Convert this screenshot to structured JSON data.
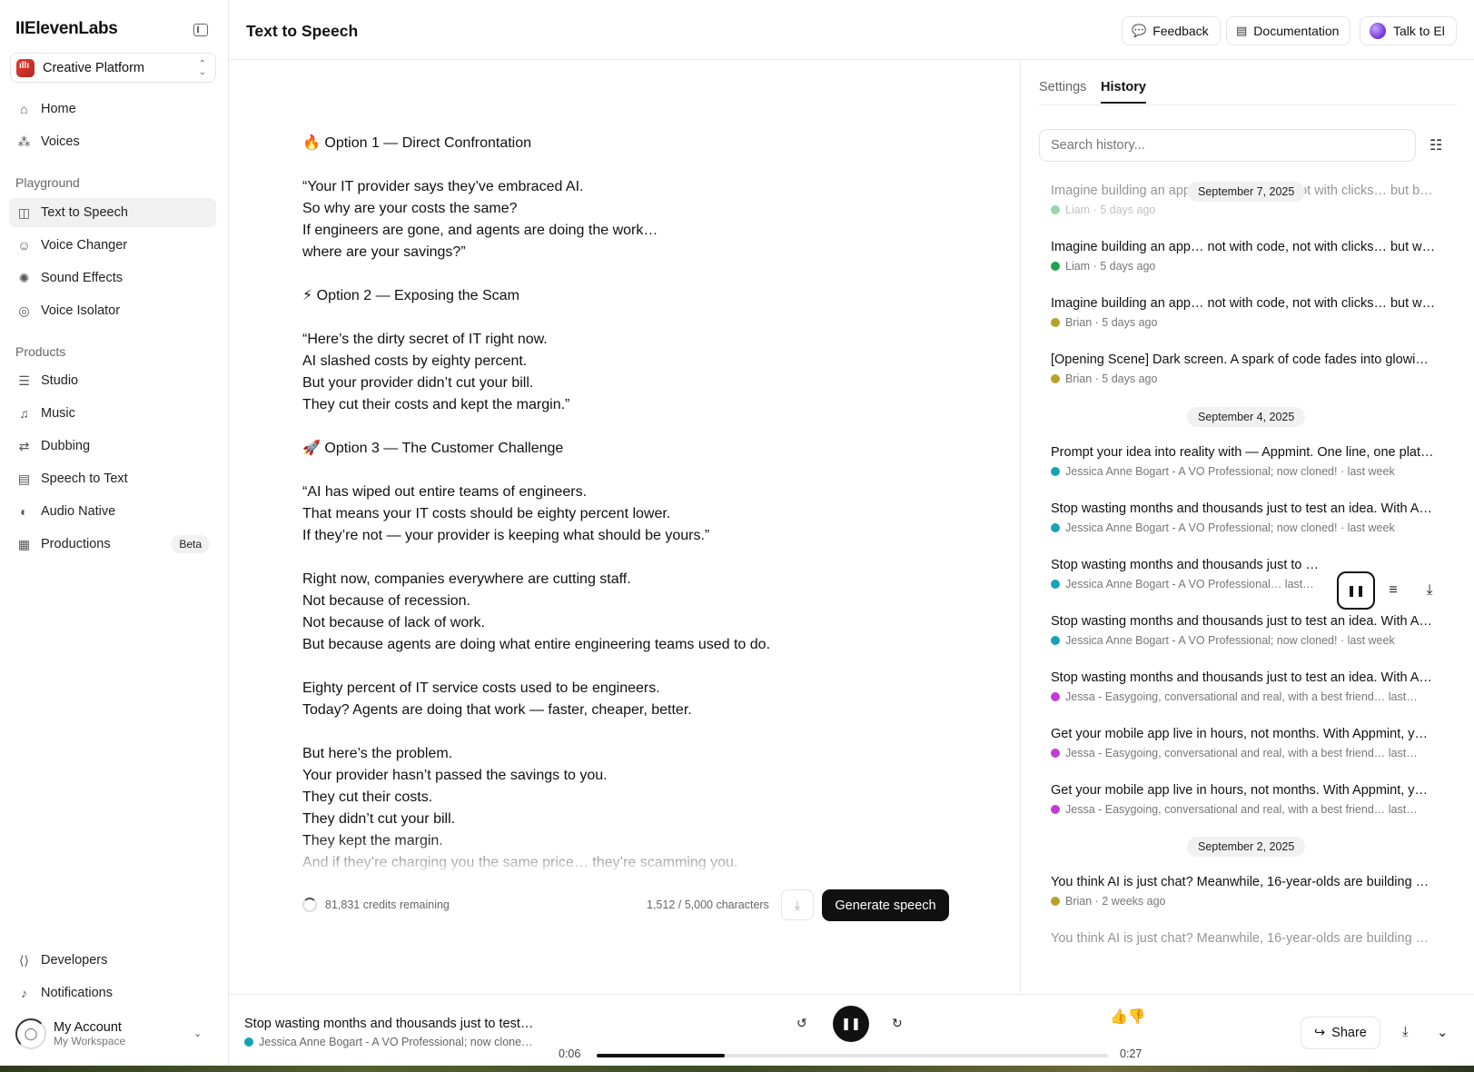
{
  "app": {
    "logo": "IIElevenLabs",
    "workspace_switcher": "Creative Platform",
    "page_title": "Text to Speech"
  },
  "sidebar": {
    "top_items": [
      {
        "label": "Home",
        "icon": "home-icon"
      },
      {
        "label": "Voices",
        "icon": "voices-icon"
      }
    ],
    "playground_label": "Playground",
    "playground_items": [
      {
        "label": "Text to Speech",
        "icon": "tts-icon",
        "active": true
      },
      {
        "label": "Voice Changer",
        "icon": "voice-changer-icon"
      },
      {
        "label": "Sound Effects",
        "icon": "sound-effects-icon"
      },
      {
        "label": "Voice Isolator",
        "icon": "voice-isolator-icon"
      }
    ],
    "products_label": "Products",
    "products_items": [
      {
        "label": "Studio",
        "icon": "studio-icon"
      },
      {
        "label": "Music",
        "icon": "music-icon"
      },
      {
        "label": "Dubbing",
        "icon": "dubbing-icon"
      },
      {
        "label": "Speech to Text",
        "icon": "speech-to-text-icon"
      },
      {
        "label": "Audio Native",
        "icon": "audio-native-icon"
      },
      {
        "label": "Productions",
        "icon": "productions-icon",
        "badge": "Beta"
      }
    ],
    "bottom_items": [
      {
        "label": "Developers",
        "icon": "developers-icon"
      },
      {
        "label": "Notifications",
        "icon": "bell-icon"
      }
    ],
    "account": {
      "name": "My Account",
      "workspace": "My Workspace"
    }
  },
  "header": {
    "feedback": "Feedback",
    "documentation": "Documentation",
    "talk": "Talk to El"
  },
  "editor": {
    "lines": [
      "🔥 Option 1 — Direct Confrontation",
      "",
      "“Your IT provider says they’ve embraced AI.",
      "So why are your costs the same?",
      "If engineers are gone, and agents are doing the work…",
      "where are your savings?”",
      "",
      "⚡ Option 2 — Exposing the Scam",
      "",
      "“Here’s the dirty secret of IT right now.",
      "AI slashed costs by eighty percent.",
      "But your provider didn’t cut your bill.",
      "They cut their costs and kept the margin.”",
      "",
      "🚀 Option 3 — The Customer Challenge",
      "",
      "“AI has wiped out entire teams of engineers.",
      "That means your IT costs should be eighty percent lower.",
      "If they’re not — your provider is keeping what should be yours.”",
      "",
      "Right now, companies everywhere are cutting staff.",
      "Not because of recession.",
      "Not because of lack of work.",
      "But because agents are doing what entire engineering teams used to do.",
      "",
      "Eighty percent of IT service costs used to be engineers.",
      "Today? Agents are doing that work — faster, cheaper, better.",
      "",
      "But here’s the problem.",
      "Your provider hasn’t passed the savings to you.",
      "They cut their costs.",
      "They didn’t cut your bill.",
      "They kept the margin.",
      "And if they’re charging you the same price… they’re scamming you."
    ],
    "credits": "81,831 credits remaining",
    "characters": "1,512 / 5,000 characters",
    "generate": "Generate speech"
  },
  "history": {
    "tabs": [
      "Settings",
      "History"
    ],
    "active_tab": "History",
    "search_placeholder": "Search history...",
    "dates": [
      "September 7, 2025",
      "September 4, 2025",
      "September 2, 2025"
    ],
    "items": [
      {
        "title": "Imagine building an app… not with code, not with clicks… but b…",
        "meta": "Liam · 5 days ago",
        "color": "#1fa34a",
        "dim": true
      },
      {
        "title": "Imagine building an app… not with code, not with clicks… but w…",
        "meta": "Liam · 5 days ago",
        "color": "#1fa34a"
      },
      {
        "title": "Imagine building an app… not with code, not with clicks… but w…",
        "meta": "Brian · 5 days ago",
        "color": "#b8a12a"
      },
      {
        "title": "[Opening Scene] Dark screen. A spark of code fades into glowi…",
        "meta": "Brian · 5 days ago",
        "color": "#b8a12a"
      },
      {
        "title": "Prompt your idea into reality with — Appmint. One line, one plat…",
        "meta": "Jessica Anne Bogart - A VO Professional; now cloned! · last week",
        "color": "#17a2b8"
      },
      {
        "title": "Stop wasting months and thousands just to test an idea. With A…",
        "meta": "Jessica Anne Bogart - A VO Professional; now cloned! · last week",
        "color": "#17a2b8"
      },
      {
        "title": "Stop wasting months and thousands just to …",
        "meta": "Jessica Anne Bogart - A VO Professional… last…",
        "color": "#17a2b8"
      },
      {
        "title": "Stop wasting months and thousands just to test an idea. With A…",
        "meta": "Jessica Anne Bogart - A VO Professional; now cloned! · last week",
        "color": "#17a2b8"
      },
      {
        "title": "Stop wasting months and thousands just to test an idea. With A…",
        "meta": "Jessa - Easygoing, conversational and real, with a best friend… last…",
        "color": "#c23bd4"
      },
      {
        "title": "Get your mobile app live in hours, not months. With Appmint, y…",
        "meta": "Jessa - Easygoing, conversational and real, with a best friend… last…",
        "color": "#c23bd4"
      },
      {
        "title": "Get your mobile app live in hours, not months. With Appmint, y…",
        "meta": "Jessa - Easygoing, conversational and real, with a best friend… last…",
        "color": "#c23bd4"
      },
      {
        "title": "You think AI is just chat? Meanwhile, 16-year-olds are building …",
        "meta": "Brian · 2 weeks ago",
        "color": "#b8a12a"
      },
      {
        "title": "You think AI is just chat? Meanwhile, 16-year-olds are building …",
        "meta": "",
        "color": "#b8a12a",
        "dim": true
      }
    ]
  },
  "player": {
    "title": "Stop wasting months and thousands just to test…",
    "voice": "Jessica Anne Bogart - A VO Professional; now clone…",
    "current_time": "0:06",
    "duration": "0:27",
    "progress": 0.25,
    "share": "Share"
  },
  "colors": {
    "primary": "#111111",
    "accent_workspace": "#e43d2f"
  }
}
